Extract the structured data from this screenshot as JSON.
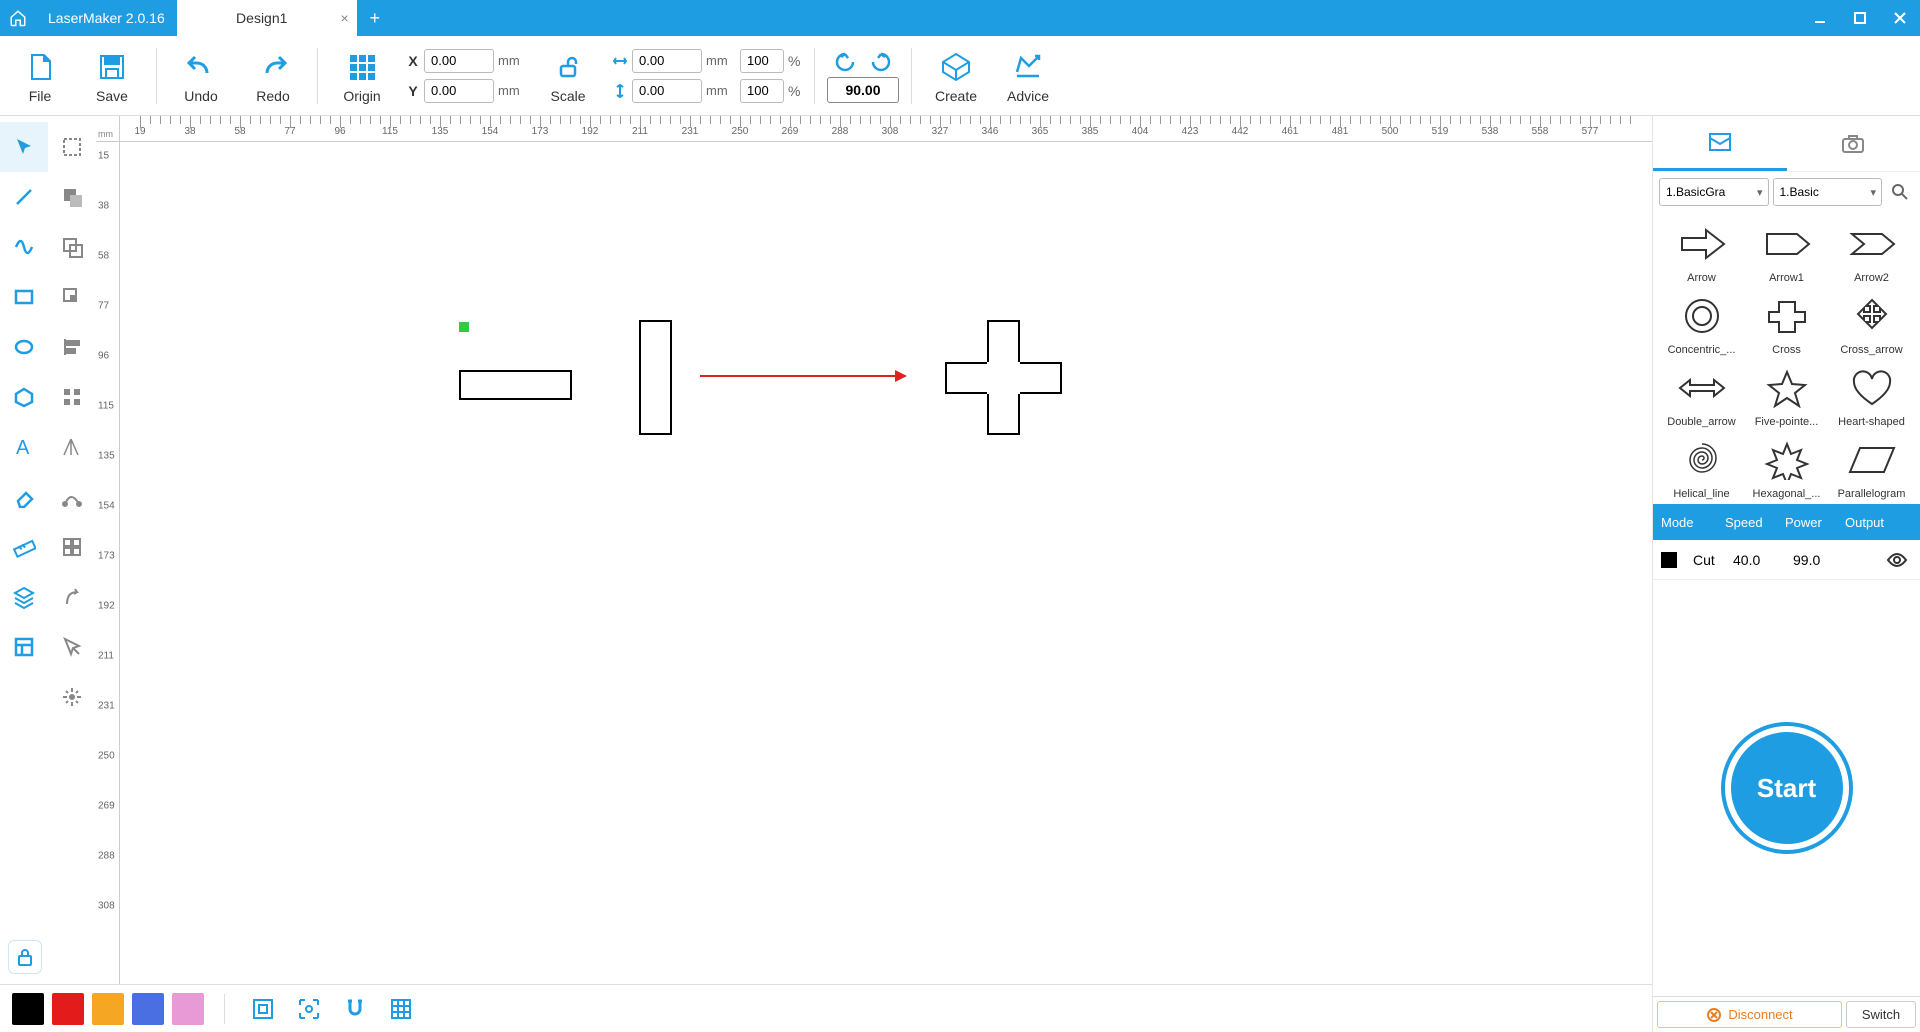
{
  "app": {
    "name": "LaserMaker 2.0.16",
    "tab": "Design1"
  },
  "toolbar": {
    "file": "File",
    "save": "Save",
    "undo": "Undo",
    "redo": "Redo",
    "origin": "Origin",
    "scale": "Scale",
    "create": "Create",
    "advice": "Advice",
    "x": "0.00",
    "y": "0.00",
    "w": "0.00",
    "h": "0.00",
    "wp": "100",
    "hp": "100",
    "mm": "mm",
    "pct": "%",
    "rot": "90.00",
    "X": "X",
    "Y": "Y"
  },
  "ruler": {
    "unit": "mm"
  },
  "right": {
    "cat1": "1.BasicGra",
    "cat2": "1.Basic",
    "shapes": [
      "Arrow",
      "Arrow1",
      "Arrow2",
      "Concentric_...",
      "Cross",
      "Cross_arrow",
      "Double_arrow",
      "Five-pointe...",
      "Heart-shaped",
      "Helical_line",
      "Hexagonal_...",
      "Parallelogram"
    ],
    "hdr": {
      "mode": "Mode",
      "speed": "Speed",
      "power": "Power",
      "output": "Output"
    },
    "row": {
      "mode": "Cut",
      "speed": "40.0",
      "power": "99.0"
    },
    "start": "Start",
    "disconnect": "Disconnect",
    "switch": "Switch"
  },
  "colors": [
    "#000000",
    "#e31b1b",
    "#f5a623",
    "#4a6fe3",
    "#e89ad6"
  ]
}
